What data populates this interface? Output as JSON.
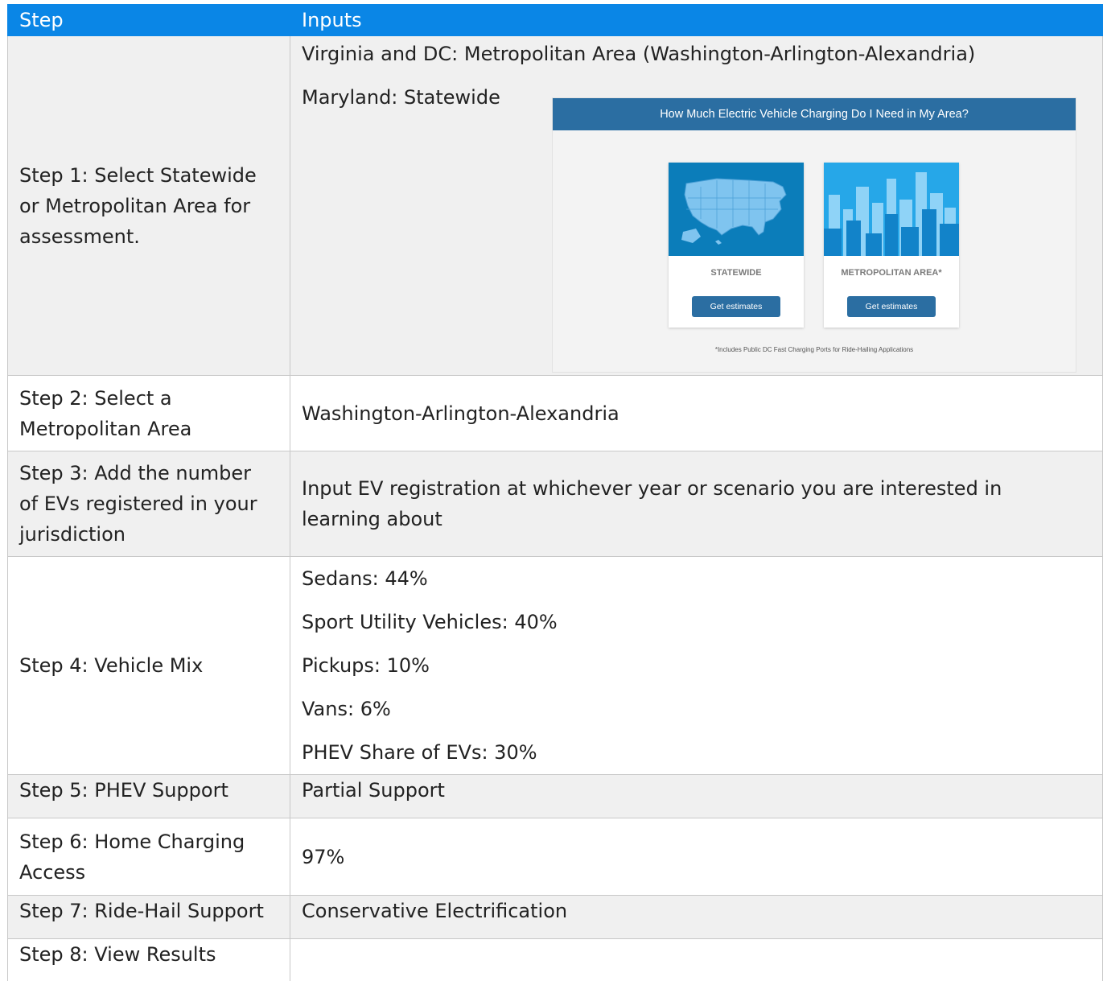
{
  "header": {
    "step": "Step",
    "inputs": "Inputs"
  },
  "rows": [
    {
      "step": [
        "Step 1: Select Statewide",
        "or Metropolitan Area for",
        "assessment."
      ],
      "inputs": [
        "Virginia and DC: Metropolitan Area (Washington-Arlington-Alexandria)",
        "Maryland: Statewide"
      ]
    },
    {
      "step": [
        "Step 2: Select a",
        "Metropolitan Area"
      ],
      "inputs": [
        "Washington-Arlington-Alexandria"
      ]
    },
    {
      "step": [
        "Step 3: Add the number",
        "of EVs registered in your",
        "jurisdiction"
      ],
      "inputs": [
        "Input EV registration at whichever year or scenario you are interested in",
        "learning about"
      ]
    },
    {
      "step": [
        "Step 4: Vehicle Mix"
      ],
      "inputs": [
        "Sedans: 44%",
        "Sport Utility Vehicles: 40%",
        "Pickups: 10%",
        "Vans: 6%",
        "PHEV Share of EVs: 30%"
      ]
    },
    {
      "step": [
        "Step 5: PHEV Support"
      ],
      "inputs": [
        "Partial Support"
      ]
    },
    {
      "step": [
        "Step 6: Home Charging",
        "Access"
      ],
      "inputs": [
        "97%"
      ]
    },
    {
      "step": [
        "Step 7: Ride-Hail Support"
      ],
      "inputs": [
        "Conservative Electrification"
      ]
    },
    {
      "step": [
        "Step 8: View Results"
      ],
      "inputs": []
    }
  ],
  "embedded_screenshot": {
    "banner": "How Much Electric Vehicle Charging Do I Need in My Area?",
    "cards": [
      {
        "label": "STATEWIDE",
        "button": "Get estimates",
        "icon": "us-map-icon"
      },
      {
        "label": "METROPOLITAN AREA*",
        "button": "Get estimates",
        "icon": "city-skyline-icon"
      }
    ],
    "footnote": "*Includes Public DC Fast Charging Ports for Ride-Hailing Applications"
  },
  "colors": {
    "header_bg": "#0a86e6",
    "banner_bg": "#2b6ea2",
    "shade_row": "#f0f0f0"
  }
}
